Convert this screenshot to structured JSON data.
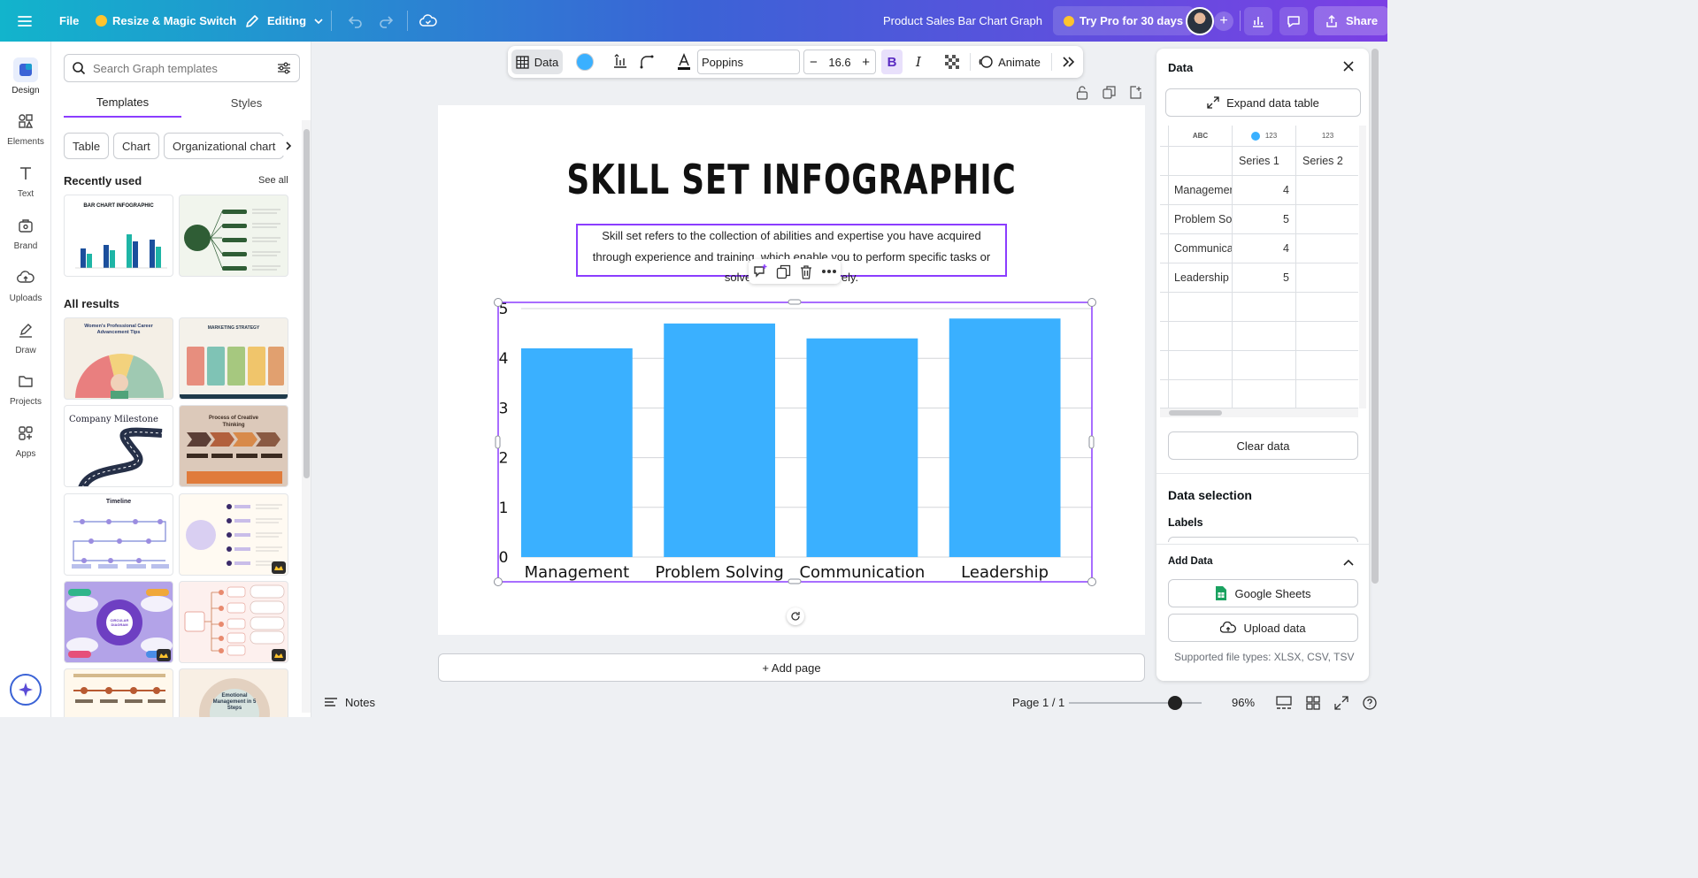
{
  "header": {
    "menu_icon": "hamburger-icon",
    "file_label": "File",
    "resize_label": "Resize & Magic Switch",
    "editing_label": "Editing",
    "doc_title": "Product Sales Bar Chart Graph",
    "try_pro_label": "Try Pro for 30 days",
    "share_label": "Share",
    "accent": "#8b3dff"
  },
  "rail": {
    "items": [
      {
        "label": "Design",
        "icon": "design-icon"
      },
      {
        "label": "Elements",
        "icon": "elements-icon"
      },
      {
        "label": "Text",
        "icon": "text-icon"
      },
      {
        "label": "Brand",
        "icon": "brand-icon"
      },
      {
        "label": "Uploads",
        "icon": "uploads-icon"
      },
      {
        "label": "Draw",
        "icon": "draw-icon"
      },
      {
        "label": "Projects",
        "icon": "projects-icon"
      },
      {
        "label": "Apps",
        "icon": "apps-icon"
      }
    ]
  },
  "panel": {
    "search_placeholder": "Search Graph templates",
    "tabs": [
      "Templates",
      "Styles"
    ],
    "chips": [
      "Table",
      "Chart",
      "Organizational chart"
    ],
    "recently_used": "Recently used",
    "see_all": "See all",
    "all_results": "All results",
    "thumbs": {
      "bar_chart_title": "BAR CHART INFOGRAPHIC",
      "womens_title": "Women's Professional Career Advancement Tips",
      "marketing_title": "MARKETING STRATEGY",
      "milestone_title": "Company Milestone",
      "process_title": "Process of Creative Thinking",
      "timeline_title": "Timeline",
      "circular_title": "CIRCULAR DIAGRAM",
      "emotional_title": "Emotional Management in 5 Steps"
    }
  },
  "toolbar": {
    "data_label": "Data",
    "font_name": "Poppins",
    "font_size": "16.6",
    "animate_label": "Animate",
    "chart_color": "#3ab0ff"
  },
  "canvas": {
    "title": "SKILL SET INFOGRAPHIC",
    "description_line1": "Skill set refers to the collection of abilities and expertise you have acquired",
    "description_line2": "through experience and training, which enable you to perform specific tasks or",
    "description_line3": "solve problems effectively.",
    "add_page_label": "+ Add page"
  },
  "chart_data": {
    "type": "bar",
    "categories": [
      "Management",
      "Problem Solving",
      "Communication",
      "Leadership"
    ],
    "series": [
      {
        "name": "Series 1",
        "values": [
          4.2,
          4.7,
          4.4,
          4.8
        ]
      }
    ],
    "ylim": [
      0,
      5
    ],
    "yticks": [
      "0",
      "1",
      "2",
      "3",
      "4",
      "5"
    ],
    "grid": true,
    "color": "#3ab0ff"
  },
  "bottom": {
    "notes_label": "Notes",
    "page_label": "Page 1 / 1",
    "zoom": "96%",
    "zoom_fraction": 0.8
  },
  "data_panel": {
    "title": "Data",
    "expand_label": "Expand data table",
    "col_types": [
      "ABC",
      "123",
      "123"
    ],
    "headers": [
      "",
      "Series 1",
      "Series 2"
    ],
    "rows": [
      {
        "label": "Managemer",
        "v1": "4",
        "v2": ""
      },
      {
        "label": "Problem So",
        "v1": "5",
        "v2": ""
      },
      {
        "label": "Communica",
        "v1": "4",
        "v2": ""
      },
      {
        "label": "Leadership",
        "v1": "5",
        "v2": ""
      }
    ],
    "clear_label": "Clear data",
    "selection_title": "Data selection",
    "labels_title": "Labels",
    "add_data_title": "Add Data",
    "google_sheets_label": "Google Sheets",
    "upload_label": "Upload data",
    "supported_label": "Supported file types: XLSX, CSV, TSV"
  }
}
